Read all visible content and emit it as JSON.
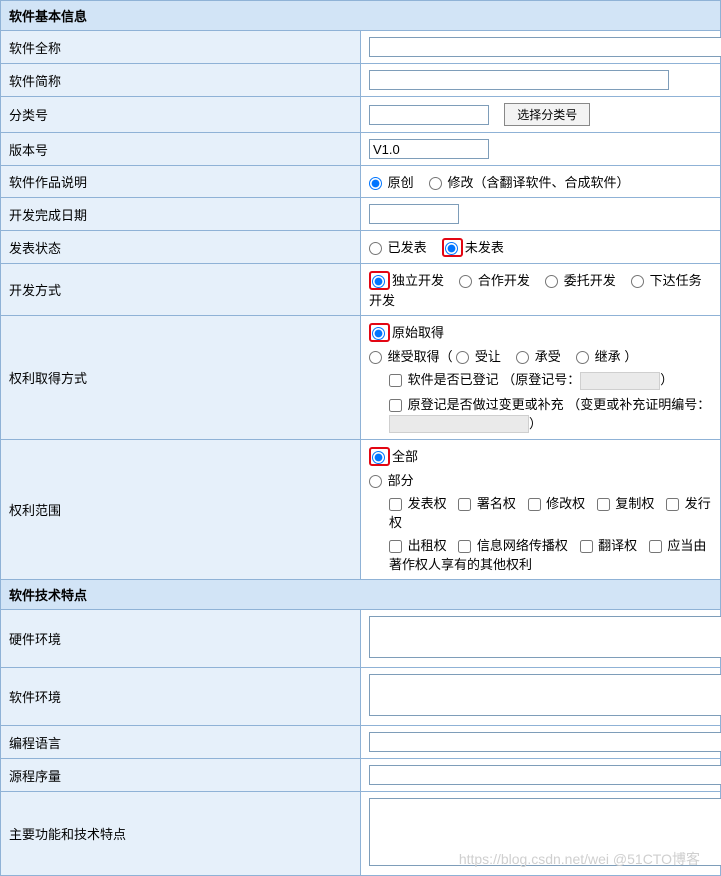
{
  "section1": {
    "title": "软件基本信息"
  },
  "fullName": {
    "label": "软件全称",
    "value": ""
  },
  "shortName": {
    "label": "软件简称",
    "value": ""
  },
  "category": {
    "label": "分类号",
    "value": "",
    "button": "选择分类号"
  },
  "version": {
    "label": "版本号",
    "value": "V1.0"
  },
  "workDesc": {
    "label": "软件作品说明",
    "opt1": "原创",
    "opt2": "修改（含翻译软件、合成软件）"
  },
  "completeDate": {
    "label": "开发完成日期",
    "value": ""
  },
  "publishStatus": {
    "label": "发表状态",
    "opt1": "已发表",
    "opt2": "未发表"
  },
  "devMode": {
    "label": "开发方式",
    "opt1": "独立开发",
    "opt2": "合作开发",
    "opt3": "委托开发",
    "opt4": "下达任务开发"
  },
  "rightsObtain": {
    "label": "权利取得方式",
    "opt1": "原始取得",
    "opt2": "继受取得（",
    "sub1": "受让",
    "sub2": "承受",
    "sub3": "继承",
    "close": "）",
    "chk1a": "软件是否已登记 （原登记号：",
    "chk1b": "）",
    "chk2a": "原登记是否做过变更或补充 （变更或补充证明编号：",
    "chk2b": "）"
  },
  "rightsScope": {
    "label": "权利范围",
    "opt1": "全部",
    "opt2": "部分",
    "c1": "发表权",
    "c2": "署名权",
    "c3": "修改权",
    "c4": "复制权",
    "c5": "发行权",
    "c6": "出租权",
    "c7": "信息网络传播权",
    "c8": "翻译权",
    "c9": "应当由著作权人享有的其他权利"
  },
  "section2": {
    "title": "软件技术特点"
  },
  "hardware": {
    "label": "硬件环境",
    "value": ""
  },
  "software": {
    "label": "软件环境",
    "value": ""
  },
  "language": {
    "label": "编程语言",
    "value": ""
  },
  "sourceSize": {
    "label": "源程序量",
    "value": ""
  },
  "features": {
    "label": "主要功能和技术特点",
    "value": ""
  },
  "watermark": "https://blog.csdn.net/wei @51CTO博客"
}
